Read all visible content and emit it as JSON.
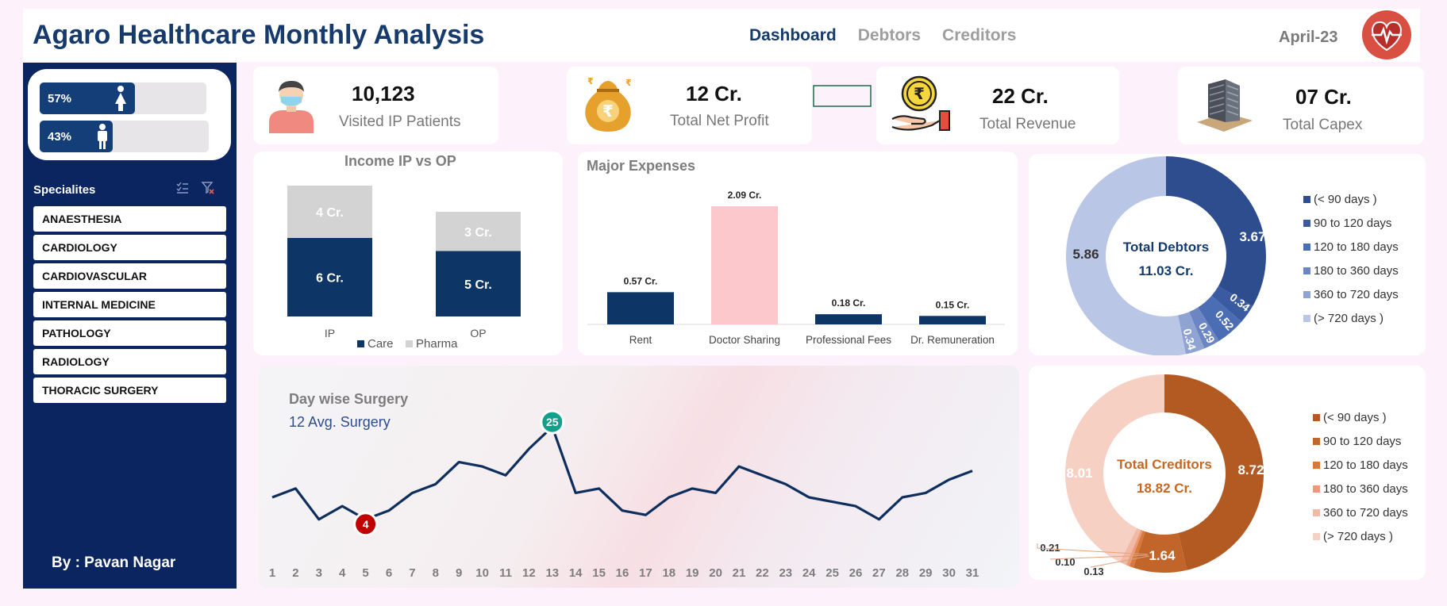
{
  "header": {
    "title": "Agaro Healthcare Monthly Analysis",
    "nav": [
      "Dashboard",
      "Debtors",
      "Creditors"
    ],
    "date": "April-23"
  },
  "sidebar": {
    "female_pct": "57%",
    "male_pct": "43%",
    "female_share": 0.57,
    "male_share": 0.43,
    "specialities_title": "Specialites",
    "specialities": [
      "ANAESTHESIA",
      "CARDIOLOGY",
      "CARDIOVASCULAR",
      "INTERNAL MEDICINE",
      "PATHOLOGY",
      "RADIOLOGY",
      "THORACIC SURGERY"
    ],
    "author": "By : Pavan Nagar"
  },
  "kpis": {
    "patients": {
      "value": "10,123",
      "label": "Visited IP Patients"
    },
    "profit": {
      "value": "12 Cr.",
      "label": "Total Net Profit"
    },
    "revenue": {
      "value": "22 Cr.",
      "label": "Total Revenue"
    },
    "capex": {
      "value": "07 Cr.",
      "label": "Total Capex"
    }
  },
  "colors": {
    "navy": "#0b2560",
    "care": "#0d3566",
    "pharma": "#d3d3d3",
    "doctor_sharing": "#fcc8cb",
    "low_marker": "#c00000",
    "high_marker": "#13a08b",
    "debtors": [
      "#2e4d8e",
      "#3a5ba1",
      "#4b6db3",
      "#6b86c3",
      "#8fa4d3",
      "#bac6e5"
    ],
    "creditors": [
      "#b25a22",
      "#c2652a",
      "#d9783a",
      "#e89b76",
      "#f2b9a4",
      "#f7d0c4"
    ]
  },
  "chart_data": [
    {
      "type": "bar",
      "title": "Income IP vs OP",
      "categories": [
        "IP",
        "OP"
      ],
      "series": [
        {
          "name": "Care",
          "values": [
            6,
            5
          ],
          "labels": [
            "6 Cr.",
            "5 Cr."
          ]
        },
        {
          "name": "Pharma",
          "values": [
            4,
            3
          ],
          "labels": [
            "4 Cr.",
            "3 Cr."
          ]
        }
      ],
      "stacked": true,
      "ylim": [
        0,
        10
      ],
      "legend": "bottom"
    },
    {
      "type": "bar",
      "title": "Major Expenses",
      "categories": [
        "Rent",
        "Doctor Sharing",
        "Professional Fees",
        "Dr. Remuneration"
      ],
      "values": [
        0.57,
        2.09,
        0.18,
        0.15
      ],
      "labels": [
        "0.57 Cr.",
        "2.09 Cr.",
        "0.18 Cr.",
        "0.15 Cr."
      ],
      "ylim": [
        0,
        2.09
      ]
    },
    {
      "type": "pie",
      "title": "Total Debtors",
      "subtitle": "11.03 Cr.",
      "categories": [
        "(< 90 days )",
        "90 to 120 days",
        "120 to 180 days",
        "180 to 360 days",
        "360 to 720 days",
        "(> 720 days )"
      ],
      "values": [
        3.67,
        0.34,
        0.52,
        0.29,
        0.34,
        5.86
      ],
      "labels": [
        "3.67",
        "0.34",
        "0.52",
        "0.29",
        "0.34",
        "5.86"
      ],
      "legend": "right"
    },
    {
      "type": "pie",
      "title": "Total Creditors",
      "subtitle": "18.82 Cr.",
      "categories": [
        "(< 90 days )",
        "90 to 120 days",
        "120 to 180 days",
        "180 to 360 days",
        "360 to 720 days",
        "(> 720 days )"
      ],
      "values": [
        8.72,
        1.64,
        0.13,
        0.1,
        0.21,
        8.01
      ],
      "labels": [
        "8.72",
        "1.64",
        "0.13",
        "0.10",
        "0.21",
        "8.01"
      ],
      "legend": "right"
    },
    {
      "type": "line",
      "title": "Day wise Surgery",
      "subtitle": "12 Avg. Surgery",
      "x": [
        1,
        2,
        3,
        4,
        5,
        6,
        7,
        8,
        9,
        10,
        11,
        12,
        13,
        14,
        15,
        16,
        17,
        18,
        19,
        20,
        21,
        22,
        23,
        24,
        25,
        26,
        27,
        28,
        29,
        30,
        31
      ],
      "y": [
        9,
        11,
        4,
        7,
        4,
        6,
        10,
        12,
        17,
        16,
        14,
        20,
        25,
        10,
        11,
        6,
        5,
        9,
        11,
        10,
        16,
        14,
        12,
        9,
        8,
        7,
        4,
        9,
        10,
        13,
        15
      ],
      "min_marker": {
        "x": 5,
        "label": "4"
      },
      "max_marker": {
        "x": 13,
        "label": "25"
      },
      "ylim": [
        0,
        27
      ]
    }
  ]
}
